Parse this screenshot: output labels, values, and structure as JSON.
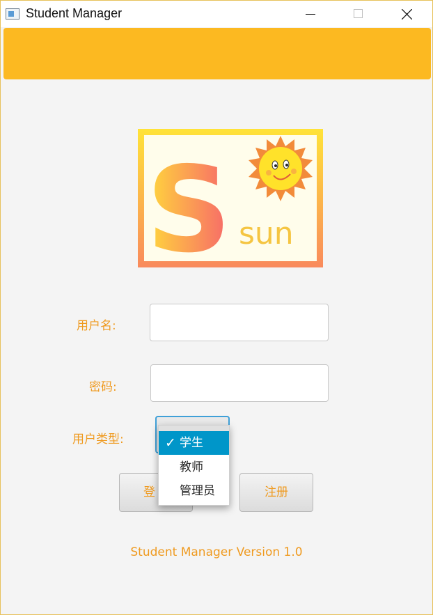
{
  "window": {
    "title": "Student Manager"
  },
  "logo": {
    "letter": "S",
    "word": "sun"
  },
  "form": {
    "username_label": "用户名:",
    "password_label": "密码:",
    "usertype_label": "用户类型:",
    "username_value": "",
    "password_value": ""
  },
  "usertype": {
    "selected": "学生",
    "options": [
      "学生",
      "教师",
      "管理员"
    ],
    "check": "✓"
  },
  "buttons": {
    "login": "登",
    "register": "注册"
  },
  "footer": {
    "version": "Student Manager Version 1.0"
  },
  "colors": {
    "banner": "#fcb921",
    "label": "#ef9a1f",
    "selected": "#0096c9"
  }
}
